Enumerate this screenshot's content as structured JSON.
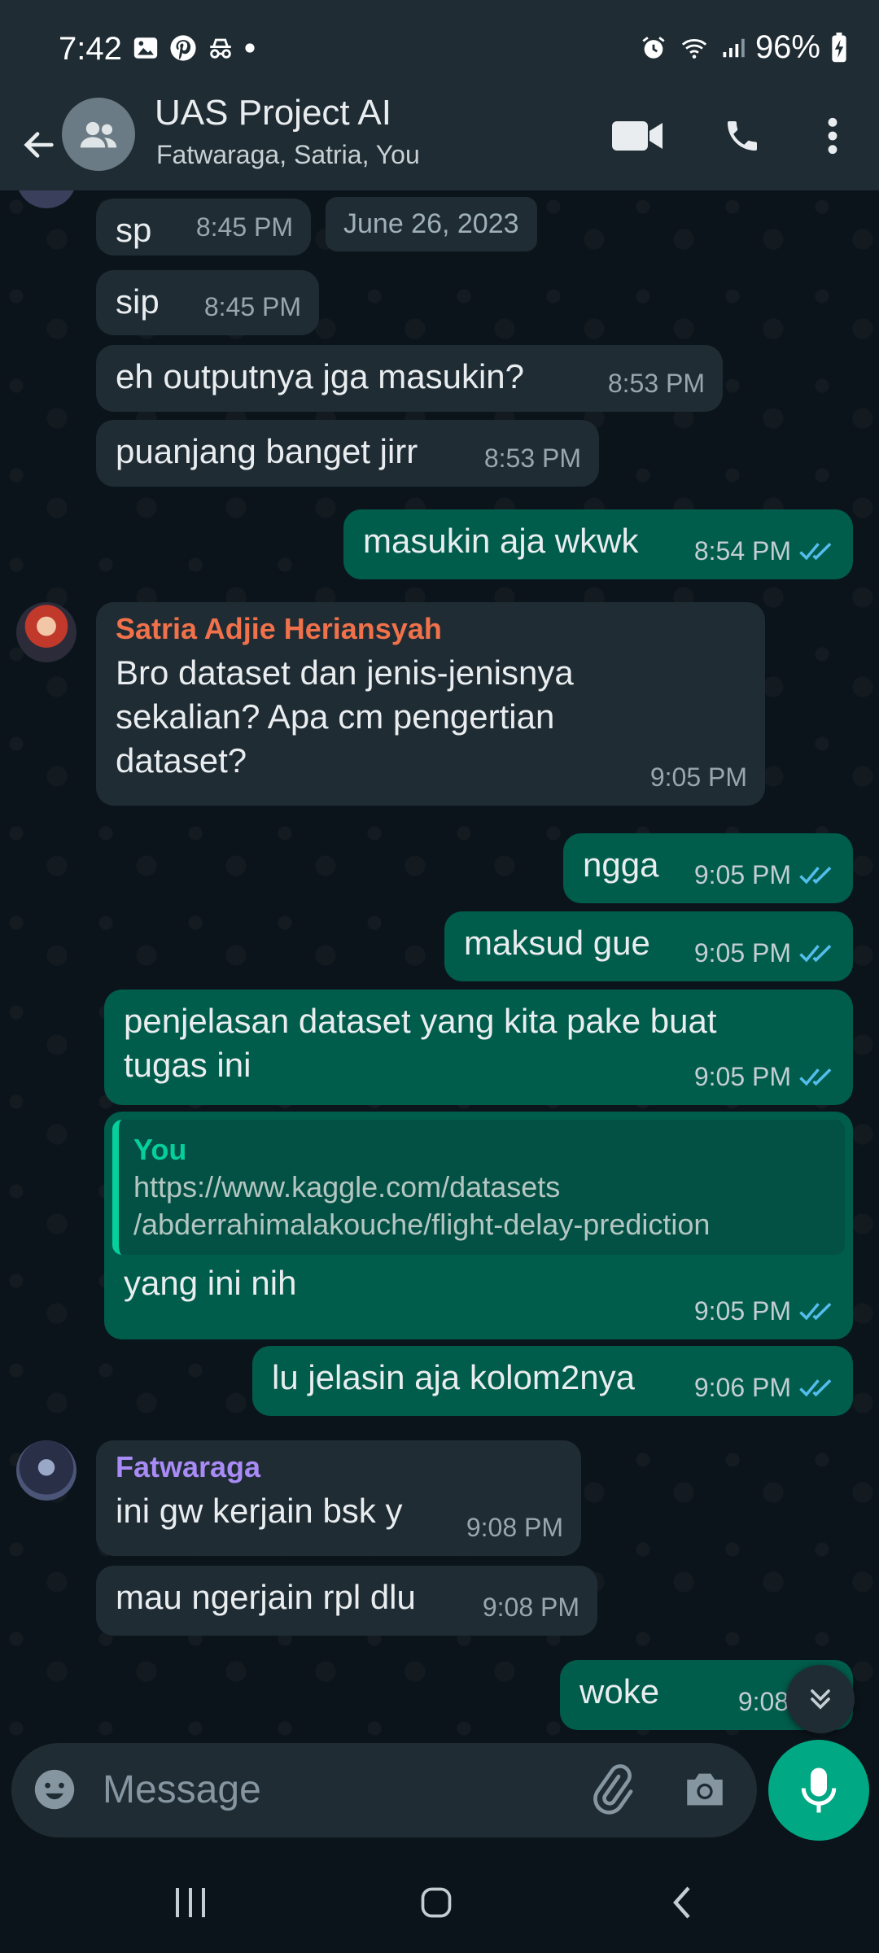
{
  "status_bar": {
    "time": "7:42",
    "battery": "96%",
    "left_icons": [
      "gallery-icon",
      "pinterest-icon",
      "incognito-icon",
      "dot-icon"
    ],
    "right_icons": [
      "alarm-icon",
      "wifi-icon",
      "signal-icon",
      "battery-charging-icon"
    ]
  },
  "header": {
    "title": "UAS Project AI",
    "subtitle": "Fatwaraga, Satria, You"
  },
  "date_chip": "June 26, 2023",
  "messages": [
    {
      "text": "sp",
      "time": "8:45 PM"
    },
    {
      "text": "sip",
      "time": "8:45 PM"
    },
    {
      "text": "eh outputnya jga  masukin?",
      "time": "8:53 PM"
    },
    {
      "text": "puanjang banget jirr",
      "time": "8:53 PM"
    },
    {
      "text": "masukin aja wkwk",
      "time": "8:54 PM"
    },
    {
      "sender": "Satria Adjie Heriansyah",
      "text_lines": [
        "Bro dataset dan jenis-jenisnya",
        "sekalian? Apa cm pengertian",
        "dataset?"
      ],
      "time": "9:05 PM"
    },
    {
      "text": "ngga",
      "time": "9:05 PM"
    },
    {
      "text": "maksud gue",
      "time": "9:05 PM"
    },
    {
      "text_lines": [
        "penjelasan dataset yang kita pake buat",
        "tugas ini"
      ],
      "time": "9:05 PM"
    },
    {
      "quote_name": "You",
      "quote_lines": [
        "https://www.kaggle.com/datasets",
        "/abderrahimalakouche/flight-delay-prediction"
      ],
      "text": "yang ini nih",
      "time": "9:05 PM"
    },
    {
      "text": "lu jelasin aja kolom2nya",
      "time": "9:06 PM"
    },
    {
      "sender": "Fatwaraga",
      "text": "ini gw kerjain bsk y",
      "time": "9:08 PM"
    },
    {
      "text": "mau ngerjain rpl dlu",
      "time": "9:08 PM"
    },
    {
      "text": "woke",
      "time": "9:08 PM"
    }
  ],
  "input": {
    "placeholder": "Message"
  },
  "colors": {
    "accent": "#00a884",
    "outgoing_bubble": "#005c4b",
    "incoming_bubble": "#1f2c34",
    "sender_satria": "#f0714a",
    "sender_fatwaraga": "#a98bf5",
    "read_ticks": "#53bdeb"
  }
}
